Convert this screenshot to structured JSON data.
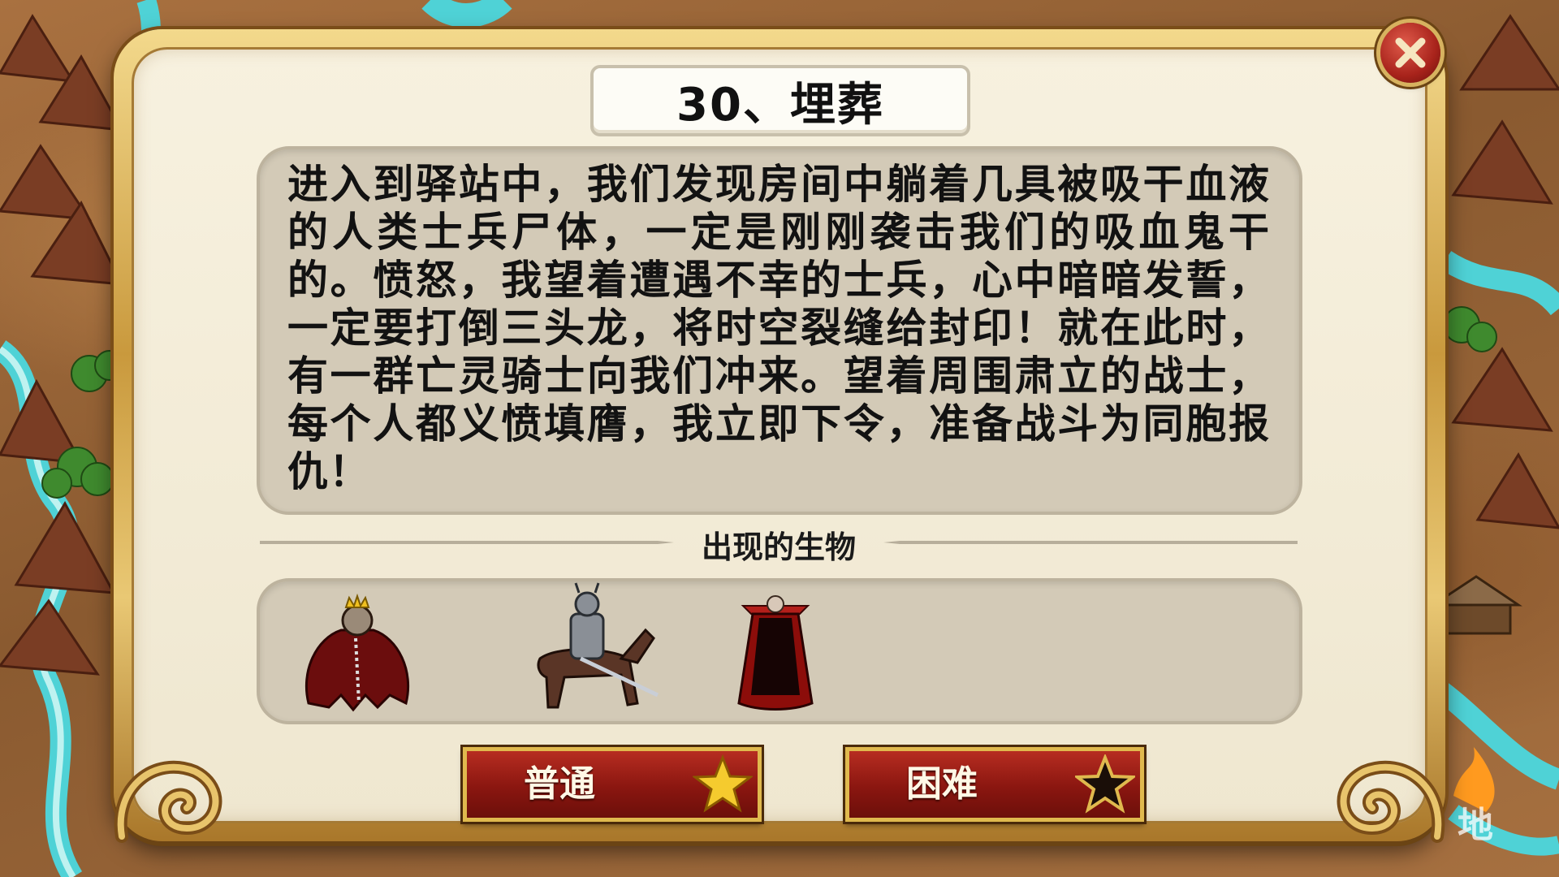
{
  "dialog": {
    "title": "30、埋葬",
    "story": "进入到驿站中，我们发现房间中躺着几具被吸干血液的人类士兵尸体，一定是刚刚袭击我们的吸血鬼干的。愤怒，我望着遭遇不幸的士兵，心中暗暗发誓，一定要打倒三头龙，将时空裂缝给封印！就在此时，有一群亡灵骑士向我们冲来。望着周围肃立的战士，每个人都义愤填膺，我立即下令，准备战斗为同胞报仇！",
    "creatures_label": "出现的生物",
    "creatures": [
      {
        "icon": "crowned-vampire-lord-icon"
      },
      {
        "icon": "death-knight-rider-icon"
      },
      {
        "icon": "caped-vampire-icon"
      }
    ],
    "buttons": {
      "normal_label": "普通",
      "hard_label": "困难"
    }
  },
  "map": {
    "corner_label": "地"
  },
  "colors": {
    "button_red": "#8a1610",
    "frame_gold": "#c9993d",
    "river": "#4fd2d6"
  }
}
